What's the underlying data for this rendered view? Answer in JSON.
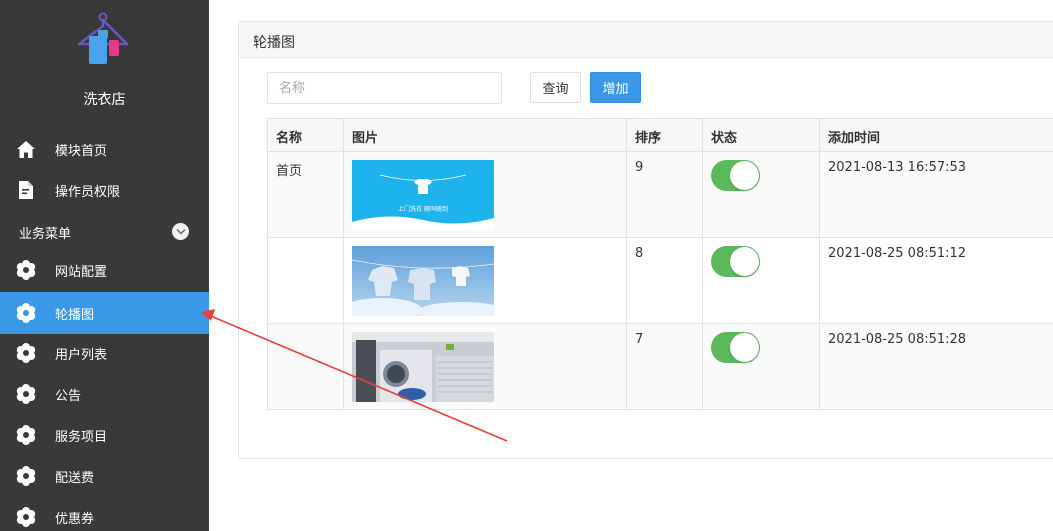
{
  "sidebar": {
    "shop_name": "洗衣店",
    "items": [
      {
        "label": "模块首页",
        "icon": "home-icon"
      },
      {
        "label": "操作员权限",
        "icon": "document-edit-icon"
      }
    ],
    "group": {
      "label": "业务菜单",
      "icon": "chevron-down-icon"
    },
    "group_items": [
      {
        "label": "网站配置",
        "icon": "gear-icon"
      },
      {
        "label": "轮播图",
        "icon": "gear-icon",
        "active": true
      },
      {
        "label": "用户列表",
        "icon": "gear-icon"
      },
      {
        "label": "公告",
        "icon": "gear-icon"
      },
      {
        "label": "服务项目",
        "icon": "gear-icon"
      },
      {
        "label": "配送费",
        "icon": "gear-icon"
      },
      {
        "label": "优惠券",
        "icon": "gear-icon"
      }
    ]
  },
  "panel": {
    "title": "轮播图",
    "search": {
      "placeholder": "名称",
      "value": ""
    },
    "query_label": "查询",
    "add_label": "增加"
  },
  "table": {
    "columns": [
      "名称",
      "图片",
      "排序",
      "状态",
      "添加时间"
    ],
    "rows": [
      {
        "name": "首页",
        "image": "laundry-banner-blue",
        "image_text": "上门洗衣    随叫随到",
        "sort": "9",
        "status_on": true,
        "added": "2021-08-13 16:57:53"
      },
      {
        "name": "",
        "image": "clothes-sky",
        "sort": "8",
        "status_on": true,
        "added": "2021-08-25 08:51:12"
      },
      {
        "name": "",
        "image": "washing-machine-room",
        "sort": "7",
        "status_on": true,
        "added": "2021-08-25 08:51:28"
      }
    ]
  },
  "colors": {
    "sidebar_bg": "#393939",
    "active_bg": "#3a98e8",
    "switch_on": "#5cb85c",
    "annotation_arrow": "#e8403a"
  }
}
